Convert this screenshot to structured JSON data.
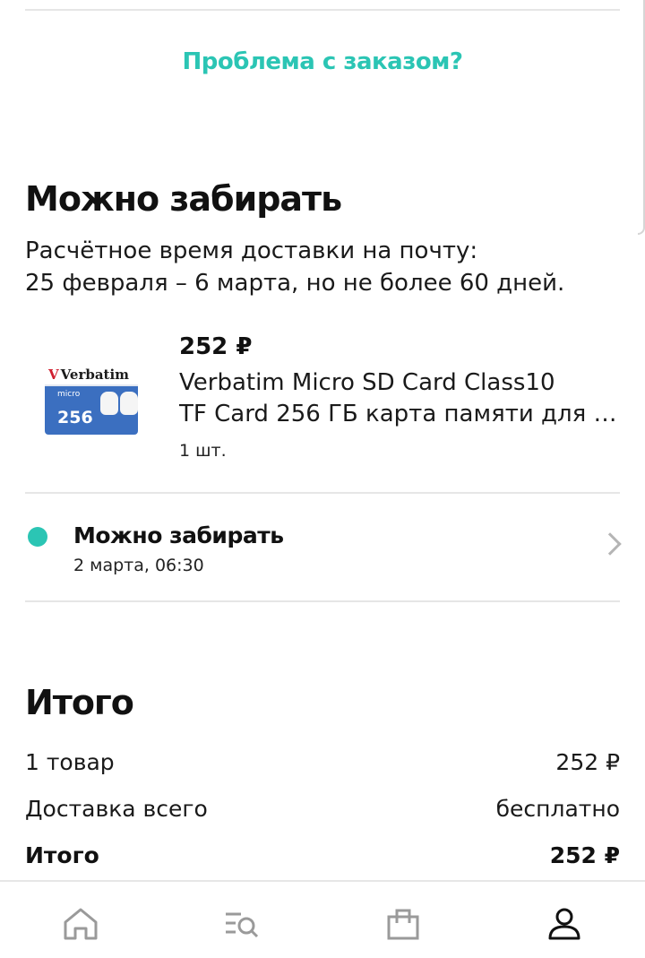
{
  "problem_link": "Проблема с заказом?",
  "shipment": {
    "title": "Можно забирать",
    "delivery_note_line1": "Расчётное время доставки на почту:",
    "delivery_note_line2": "25 февраля – 6 марта, но не более 60 дней."
  },
  "product": {
    "price": "252 ₽",
    "name_line1": "Verbatim Micro SD Card Class10",
    "name_line2": "TF Card 256 ГБ карта памяти для с...",
    "quantity": "1 шт.",
    "thumb_brand": "Verbatim",
    "thumb_capacity": "256",
    "thumb_micro": "micro"
  },
  "status": {
    "title": "Можно забирать",
    "date": "2 марта, 06:30",
    "dot_color": "#2bc5b4"
  },
  "totals": {
    "title": "Итого",
    "items_label": "1 товар",
    "items_value": "252 ₽",
    "delivery_label": "Доставка всего",
    "delivery_value": "бесплатно",
    "total_label": "Итого",
    "total_value": "252 ₽"
  },
  "nav": {
    "items": [
      {
        "icon": "home-icon"
      },
      {
        "icon": "catalog-search-icon"
      },
      {
        "icon": "shopping-bag-icon"
      },
      {
        "icon": "profile-icon",
        "active": true
      }
    ]
  },
  "colors": {
    "accent": "#2bc5b4",
    "text": "#111111",
    "divider": "#e6e6e6",
    "nav_inactive": "#9a9a9a",
    "nav_active": "#111111"
  }
}
